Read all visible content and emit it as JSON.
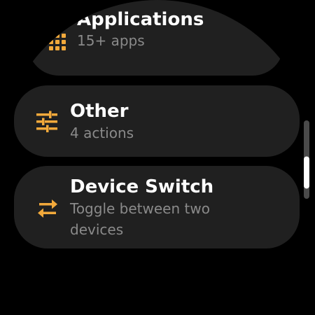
{
  "colors": {
    "background": "#000000",
    "chip": "#202020",
    "title_text": "#ffffff",
    "subtitle_text": "#8a8a8a",
    "icon_accent": "#f2a93b",
    "scroll_track": "#4a4a4a",
    "scroll_thumb": "#ffffff"
  },
  "menu": {
    "items": [
      {
        "title": "Applications",
        "subtitle": "15+ apps",
        "icon": "apps-grid-icon"
      },
      {
        "title": "Other",
        "subtitle": "4 actions",
        "icon": "sliders-icon"
      },
      {
        "title": "Device Switch",
        "subtitle": "Toggle between two devices",
        "icon": "swap-arrows-icon"
      }
    ]
  },
  "scroll": {
    "position": 0.78
  }
}
